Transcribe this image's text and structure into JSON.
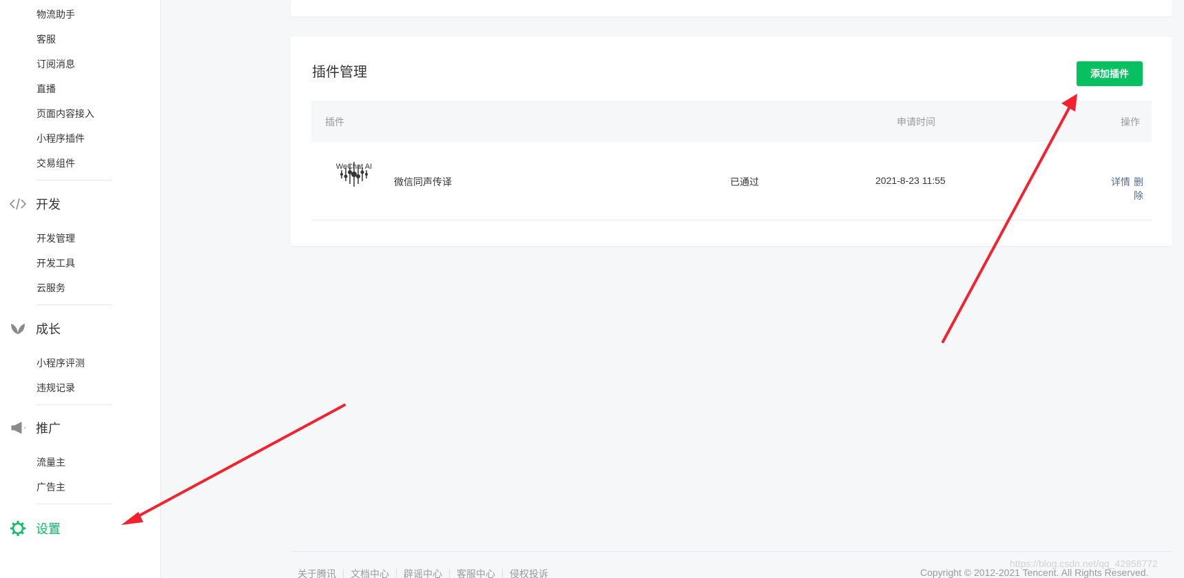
{
  "sidebar": {
    "items_top": [
      {
        "label": "物流助手"
      },
      {
        "label": "客服"
      },
      {
        "label": "订阅消息"
      },
      {
        "label": "直播"
      },
      {
        "label": "页面内容接入"
      },
      {
        "label": "小程序插件"
      },
      {
        "label": "交易组件"
      }
    ],
    "groups": [
      {
        "label": "开发",
        "icon": "code-icon",
        "items": [
          {
            "label": "开发管理"
          },
          {
            "label": "开发工具"
          },
          {
            "label": "云服务"
          }
        ]
      },
      {
        "label": "成长",
        "icon": "leaf-icon",
        "items": [
          {
            "label": "小程序评测"
          },
          {
            "label": "违规记录"
          }
        ]
      },
      {
        "label": "推广",
        "icon": "megaphone-icon",
        "items": [
          {
            "label": "流量主"
          },
          {
            "label": "广告主"
          }
        ]
      },
      {
        "label": "设置",
        "icon": "gear-icon",
        "active": true
      }
    ]
  },
  "plugin_card": {
    "title": "插件管理",
    "add_button": "添加插件",
    "columns": {
      "plugin": "插件",
      "apply_time": "申请时间",
      "actions": "操作"
    },
    "rows": [
      {
        "logo_text": "WeChat AI",
        "name": "微信同声传译",
        "status": "已通过",
        "apply_time": "2021-8-23 11:55",
        "detail": "详情",
        "delete": "删除"
      }
    ]
  },
  "footer": {
    "links": [
      "关于腾讯",
      "文档中心",
      "辟谣中心",
      "客服中心",
      "侵权投诉"
    ],
    "copyright": "Copyright © 2012-2021 Tencent. All Rights Reserved.",
    "watermark": "https://blog.csdn.net/qq_42958772"
  },
  "colors": {
    "accent": "#07c160",
    "link": "#576b95",
    "annotation_arrow": "#f5222d"
  }
}
